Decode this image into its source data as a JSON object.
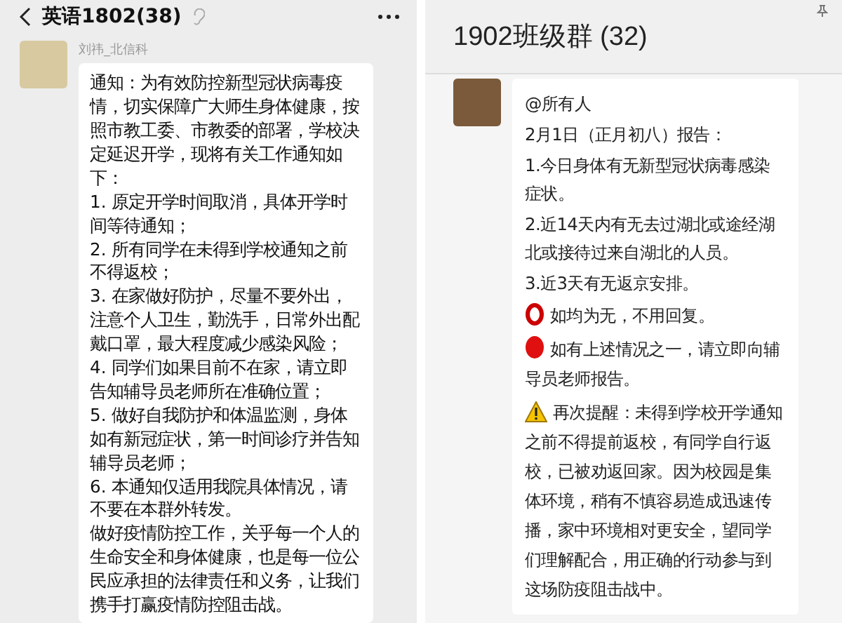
{
  "left_chat": {
    "title": "英语1802(38)",
    "messages": [
      {
        "sender": "刘祎_北信科",
        "paragraphs": [
          "通知：为有效防控新型冠状病毒疫情，切实保障广大师生身体健康，按照市教工委、市教委的部署，学校决定延迟开学，现将有关工作通知如下：",
          "1. 原定开学时间取消，具体开学时间等待通知；",
          "2. 所有同学在未得到学校通知之前不得返校；",
          "3. 在家做好防护，尽量不要外出，注意个人卫生，勤洗手，日常外出配戴口罩，最大程度减少感染风险；",
          "4. 同学们如果目前不在家，请立即告知辅导员老师所在准确位置；",
          "5. 做好自我防护和体温监测，身体如有新冠症状，第一时间诊疗并告知辅导员老师；",
          "6. 本通知仅适用我院具体情况，请不要在本群外转发。",
          "做好疫情防控工作，关乎每一个人的生命安全和身体健康，也是每一位公民应承担的法律责任和义务，让我们携手打赢疫情防控阻击战。"
        ]
      }
    ]
  },
  "right_chat": {
    "title": "1902班级群 (32)",
    "messages": [
      {
        "paragraphs": [
          {
            "kind": "text",
            "text": "@所有人"
          },
          {
            "kind": "text",
            "text": "2月1日（正月初八）报告："
          },
          {
            "kind": "text",
            "text": "1.今日身体有无新型冠状病毒感染症状。"
          },
          {
            "kind": "text",
            "text": "2.近14天内有无去过湖北或途经湖北或接待过来自湖北的人员。"
          },
          {
            "kind": "text",
            "text": "3.近3天有无返京安排。"
          },
          {
            "kind": "ring",
            "text": "如均为无，不用回复。"
          },
          {
            "kind": "dot",
            "text": "如有上述情况之一，请立即向辅导员老师报告。"
          },
          {
            "kind": "warning",
            "text": "再次提醒：未得到学校开学通知之前不得提前返校，有同学自行返校，已被劝返回家。因为校园是集体环境，稍有不慎容易造成迅速传播，家中环境相对更安全，望同学们理解配合，用正确的行动参与到这场防疫阻击战中。"
          }
        ]
      }
    ]
  }
}
